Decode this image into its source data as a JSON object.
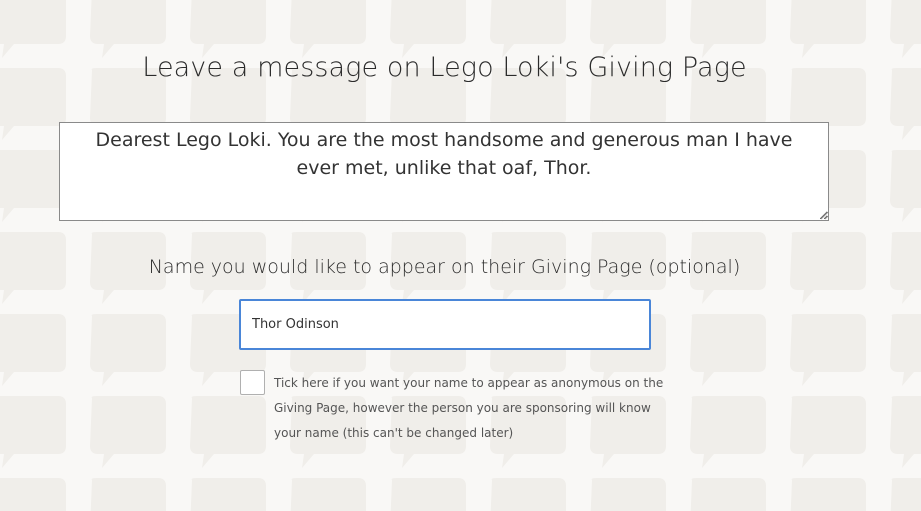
{
  "page": {
    "title": "Leave a message on Lego Loki's Giving Page"
  },
  "message": {
    "value": "Dearest Lego Loki. You are the most handsome and generous man I have ever met, unlike that oaf, Thor."
  },
  "name_field": {
    "label": "Name you would like to appear on their Giving Page (optional)",
    "value": "Thor Odinson"
  },
  "anonymous": {
    "checked": false,
    "label": "Tick here if you want your name to appear as anonymous on the Giving Page, however the person you are sponsoring will know your name (this can't be changed later)"
  },
  "colors": {
    "background": "#f9f8f6",
    "bubble_pattern": "#f0eeea",
    "input_focus_border": "#4a86d8",
    "text": "#333333"
  },
  "icons": {
    "background": "speech-bubble-pattern",
    "textarea_corner": "resize-grip-icon"
  }
}
